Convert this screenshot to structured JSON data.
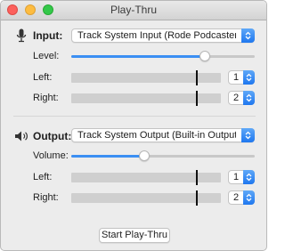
{
  "window": {
    "title": "Play-Thru"
  },
  "input": {
    "section_label": "Input:",
    "icon": "microphone-icon",
    "device": "Track System Input (Rode Podcaster)",
    "level_label": "Level:",
    "level_value": 0.73,
    "left_label": "Left:",
    "left_peak": 0.84,
    "left_channel": "1",
    "right_label": "Right:",
    "right_peak": 0.84,
    "right_channel": "2"
  },
  "output": {
    "section_label": "Output:",
    "icon": "speaker-icon",
    "device": "Track System Output (Built-in Output: He",
    "volume_label": "Volume:",
    "volume_value": 0.4,
    "left_label": "Left:",
    "left_peak": 0.84,
    "left_channel": "1",
    "right_label": "Right:",
    "right_peak": 0.84,
    "right_channel": "2"
  },
  "actions": {
    "start_label": "Start Play-Thru"
  },
  "colors": {
    "accent": "#3b8ff3",
    "popup_accent": "#1f77ef"
  }
}
